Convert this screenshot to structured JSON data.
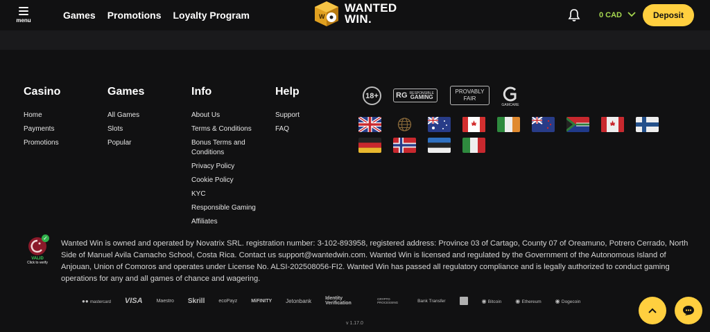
{
  "header": {
    "menu_label": "menu",
    "nav": [
      "Games",
      "Promotions",
      "Loyalty Program"
    ],
    "logo_line1": "WANTED",
    "logo_line2": "WIN.",
    "balance": "0 CAD",
    "deposit_label": "Deposit"
  },
  "footer": {
    "columns": [
      {
        "title": "Casino",
        "links": [
          "Home",
          "Payments",
          "Promotions"
        ]
      },
      {
        "title": "Games",
        "links": [
          "All Games",
          "Slots",
          "Popular"
        ]
      },
      {
        "title": "Info",
        "links": [
          "About Us",
          "Terms & Conditions",
          "Bonus Terms and Conditions",
          "Privacy Policy",
          "Cookie Policy",
          "KYC",
          "Responsible Gaming",
          "Affiliates"
        ]
      },
      {
        "title": "Help",
        "links": [
          "Support",
          "FAQ"
        ]
      }
    ],
    "badges": {
      "age": "18+",
      "rg_logo": "RG",
      "rg_small": "RESPONSIBLE",
      "rg_big": "GAMING",
      "provably_fair": "PROVABLY FAIR",
      "gamcare": "GAMCARE"
    },
    "flags": [
      "uk-flag-icon",
      "globe-icon",
      "australia-flag-icon",
      "canada-flag-icon",
      "ireland-flag-icon",
      "new-zealand-flag-icon",
      "south-africa-flag-icon",
      "canada-flag-icon",
      "finland-flag-icon",
      "germany-flag-icon",
      "norway-flag-icon",
      "estonia-flag-icon",
      "italy-flag-icon"
    ],
    "license_valid": "VALID",
    "license_click": "Click to verify",
    "legal_text": "Wanted Win is owned and operated by Novatrix SRL. registration number: 3-102-893958, registered address: Province 03 of Cartago, County 07 of Oreamuno, Potrero Cerrado, North Side of Manuel Avila Camacho School, Costa Rica. Contact us support@wantedwin.com. Wanted Win is licensed and regulated by the Government of the Autonomous Island of Anjouan, Union of Comoros and operates under License No. ALSI-202508056-FI2. Wanted Win has passed all regulatory compliance and is legally authorized to conduct gaming operations for any and all games of chance and wagering.",
    "payments": [
      "mastercard",
      "VISA",
      "Maestro",
      "Skrill",
      "ecoPayz",
      "MiFINITY",
      "Jetonbank",
      "Identity Verification",
      "CRYPTO PROCESSING",
      "Bank Transfer",
      "",
      "Bitcoin",
      "Ethereum",
      "Dogecoin"
    ],
    "version": "v 1.17.0"
  },
  "colors": {
    "accent": "#ffcf3f",
    "balance": "#a6d84f",
    "bg": "#111112"
  }
}
